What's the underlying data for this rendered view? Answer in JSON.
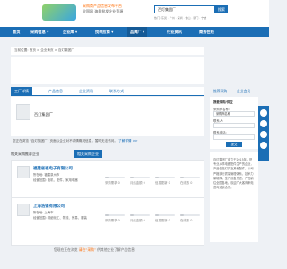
{
  "header": {
    "slogan_line1": "采购商产品信息发布平台",
    "slogan_line2": "全国网 海量批发企业资源",
    "search_value": "百灯集团厂",
    "search_button": "搜索",
    "hotwords": "热门: 东莞 · 广州 · 深圳 · 佛山 · 厦门 · 宁波"
  },
  "nav": {
    "items": [
      {
        "label": "首页"
      },
      {
        "label": "采购信息 ▾"
      },
      {
        "label": "企业库 ▾"
      },
      {
        "label": "找供应商 ▾"
      },
      {
        "label": "品牌厂 ▾"
      },
      {
        "label": "行业资讯"
      },
      {
        "label": "商务在线"
      }
    ]
  },
  "breadcrumb": "当前位置: 首页 > 企业黄页 > 百灯集团厂",
  "tabs": [
    "工厂详情",
    "产品信息",
    "企业资讯",
    "联系方式"
  ],
  "company": {
    "title": "百灯集团厂"
  },
  "notice": {
    "text": "您正在浏览 \"百灯集团厂\" 页面以企业对不详情概况信息，暂时无法访问。",
    "link": "了解详情 >>"
  },
  "section": {
    "heading": "相关采购推荐企业",
    "tab": "相关采购企业"
  },
  "cards": [
    {
      "name": "福建省福电子有限公司",
      "meta1": "所在地: 福建泉州市",
      "meta2": "经营范围: 电机、配件、家用电器",
      "metrics": [
        "采购需求 0",
        "月结金额 0",
        "信息更新 0",
        "在线数 0"
      ],
      "levels": [
        0.2,
        0.2,
        0.2,
        0.2
      ]
    },
    {
      "name": "上海浩镇有限公司",
      "meta1": "所在地: 上海市",
      "meta2": "经营范围: 精细化工、物流、贸易、服装",
      "metrics": [
        "采购需求 0",
        "月结金额 0",
        "信息更新 0",
        "在线数 0"
      ],
      "levels": [
        0.2,
        0.2,
        0.2,
        0.2
      ]
    }
  ],
  "footer": {
    "prefix": "您现在正在浏览",
    "highlight": "请在“采购”",
    "suffix": "供其他企业了解产品信息"
  },
  "sidebar": {
    "tab_left": "推荐采购",
    "tab_right": "企业会员",
    "heading": "我要采购/供应",
    "label_name": "采购商名称:",
    "value_name": "采购商名称",
    "label_contact": "联系人:",
    "value_contact": "",
    "label_phone": "联系电话:",
    "value_phone": "",
    "submit": "提交",
    "desc": "百灯集团厂成立于2015年，是专业从事电器配件生产的企业，产品包括灯具及其他配件，公司严格执行质量管理体系，技术力量雄厚，生产设备先进，产品销往全国各地，欢迎广大客商来电咨询洽谈合作。"
  },
  "colors": {
    "brand": "#1b6eb5",
    "accent": "#ff6b00",
    "background": "#eef1f5"
  },
  "icons": [
    "search-icon",
    "service-icon",
    "phone-icon",
    "wechat-icon",
    "top-icon"
  ]
}
